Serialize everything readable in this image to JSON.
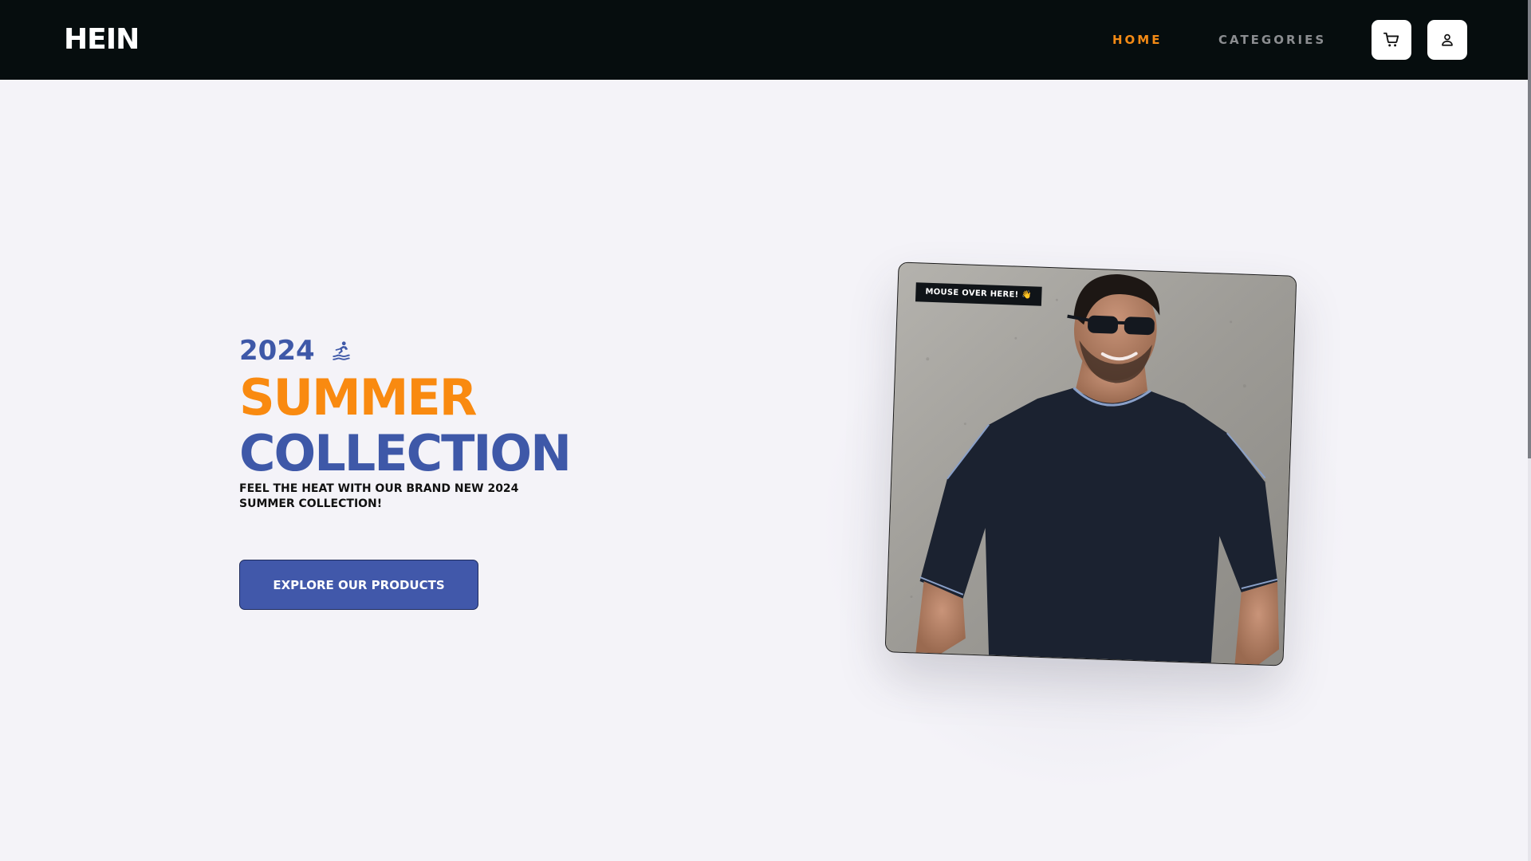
{
  "header": {
    "brand": "HEIN",
    "nav": {
      "home": "HOME",
      "categories": "CATEGORIES"
    },
    "active_color": "#f38a15",
    "icons": [
      "cart-icon",
      "user-icon"
    ]
  },
  "hero": {
    "year": "2024",
    "year_icon": "surfer-icon",
    "title_line1": "SUMMER",
    "title_line2": "COLLECTION",
    "subtitle": "FEEL THE HEAT WITH OUR BRAND NEW 2024 SUMMER COLLECTION!",
    "cta": "EXPLORE OUR PRODUCTS",
    "image_badge": "MOUSE OVER HERE! 👋",
    "colors": {
      "accent_orange": "#f98a10",
      "accent_blue": "#3e58a8",
      "background": "#f4f3f8",
      "navbar": "#060d0e"
    }
  }
}
